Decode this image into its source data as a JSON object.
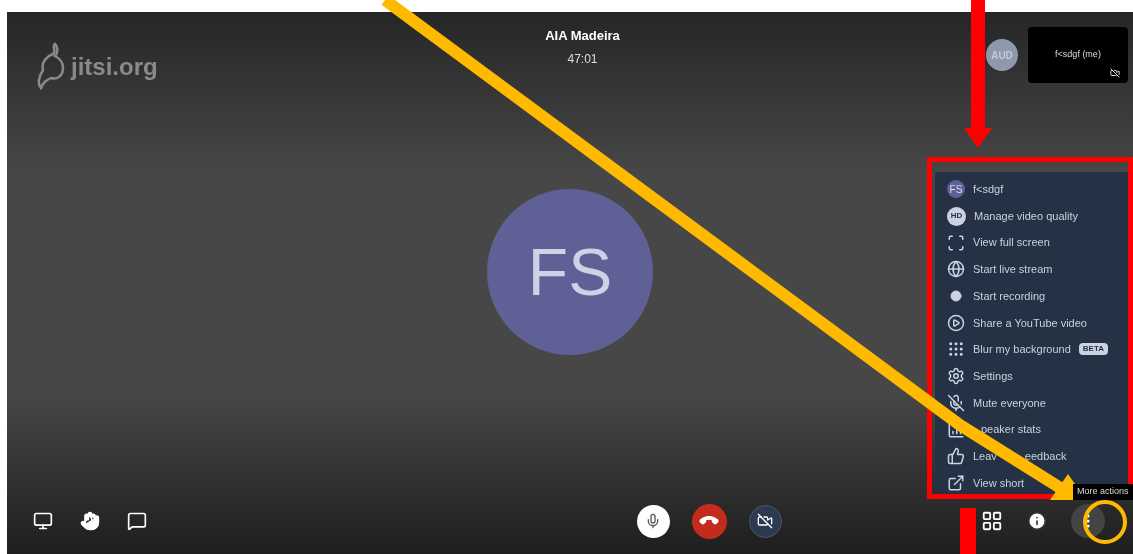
{
  "logo": {
    "text": "jitsi.org"
  },
  "header": {
    "title": "AIA Madeira",
    "timer": "47:01"
  },
  "audio_participant": {
    "initials": "AUD"
  },
  "self_view": {
    "name": "f<sdgf (me)",
    "video_muted": true
  },
  "speaker": {
    "initials": "FS"
  },
  "menu": {
    "open": true,
    "items": [
      {
        "kind": "profile",
        "initials": "FS",
        "label": "f<sdgf"
      },
      {
        "kind": "action",
        "label": "Manage video quality",
        "icon_text": "HD"
      },
      {
        "kind": "action",
        "label": "View full screen"
      },
      {
        "kind": "action",
        "label": "Start live stream"
      },
      {
        "kind": "action",
        "label": "Start recording"
      },
      {
        "kind": "action",
        "label": "Share a YouTube video"
      },
      {
        "kind": "action",
        "label": "Blur my background",
        "badge": "BETA"
      },
      {
        "kind": "action",
        "label": "Settings"
      },
      {
        "kind": "action",
        "label": "Mute everyone"
      },
      {
        "kind": "action",
        "label": "peaker stats",
        "covered_start": true
      },
      {
        "kind": "action",
        "label": "Leav",
        "label_after_cover": "eedback"
      },
      {
        "kind": "action",
        "label": "View short"
      }
    ]
  },
  "tooltip": {
    "text": "More actions"
  },
  "toolbar": {
    "mic_muted": false,
    "camera_muted": true
  }
}
